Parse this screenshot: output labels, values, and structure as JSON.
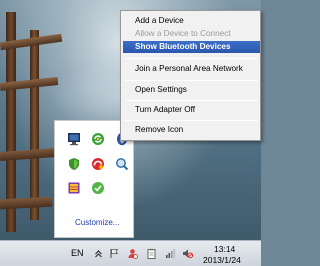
{
  "context_menu": {
    "items": [
      {
        "label": "Add a Device",
        "state": "enabled"
      },
      {
        "label": "Allow a Device to Connect",
        "state": "disabled"
      },
      {
        "label": "Show Bluetooth Devices",
        "state": "selected"
      },
      {
        "label": "Join a Personal Area Network",
        "state": "enabled"
      },
      {
        "label": "Open Settings",
        "state": "enabled"
      },
      {
        "label": "Turn Adapter Off",
        "state": "enabled"
      },
      {
        "label": "Remove Icon",
        "state": "enabled"
      }
    ]
  },
  "tray_popup": {
    "icons": [
      "network-monitor-icon",
      "green-refresh-icon",
      "bluetooth-icon",
      "shield-icon",
      "red-swirl-icon",
      "search-icon",
      "archive-icon",
      "green-check-icon"
    ],
    "customize_label": "Customize..."
  },
  "taskbar": {
    "language": "EN",
    "icons": [
      "show-hidden-icons-chevron-icon",
      "flag-icon",
      "user-alert-icon",
      "clipboard-icon",
      "signal-bars-icon",
      "volume-muted-icon"
    ],
    "time": "13:14",
    "date": "2013/1/24"
  },
  "colors": {
    "menu_highlight": "#2f5fb8",
    "link": "#1a3ca8",
    "taskbar": "#d9dfe5"
  }
}
